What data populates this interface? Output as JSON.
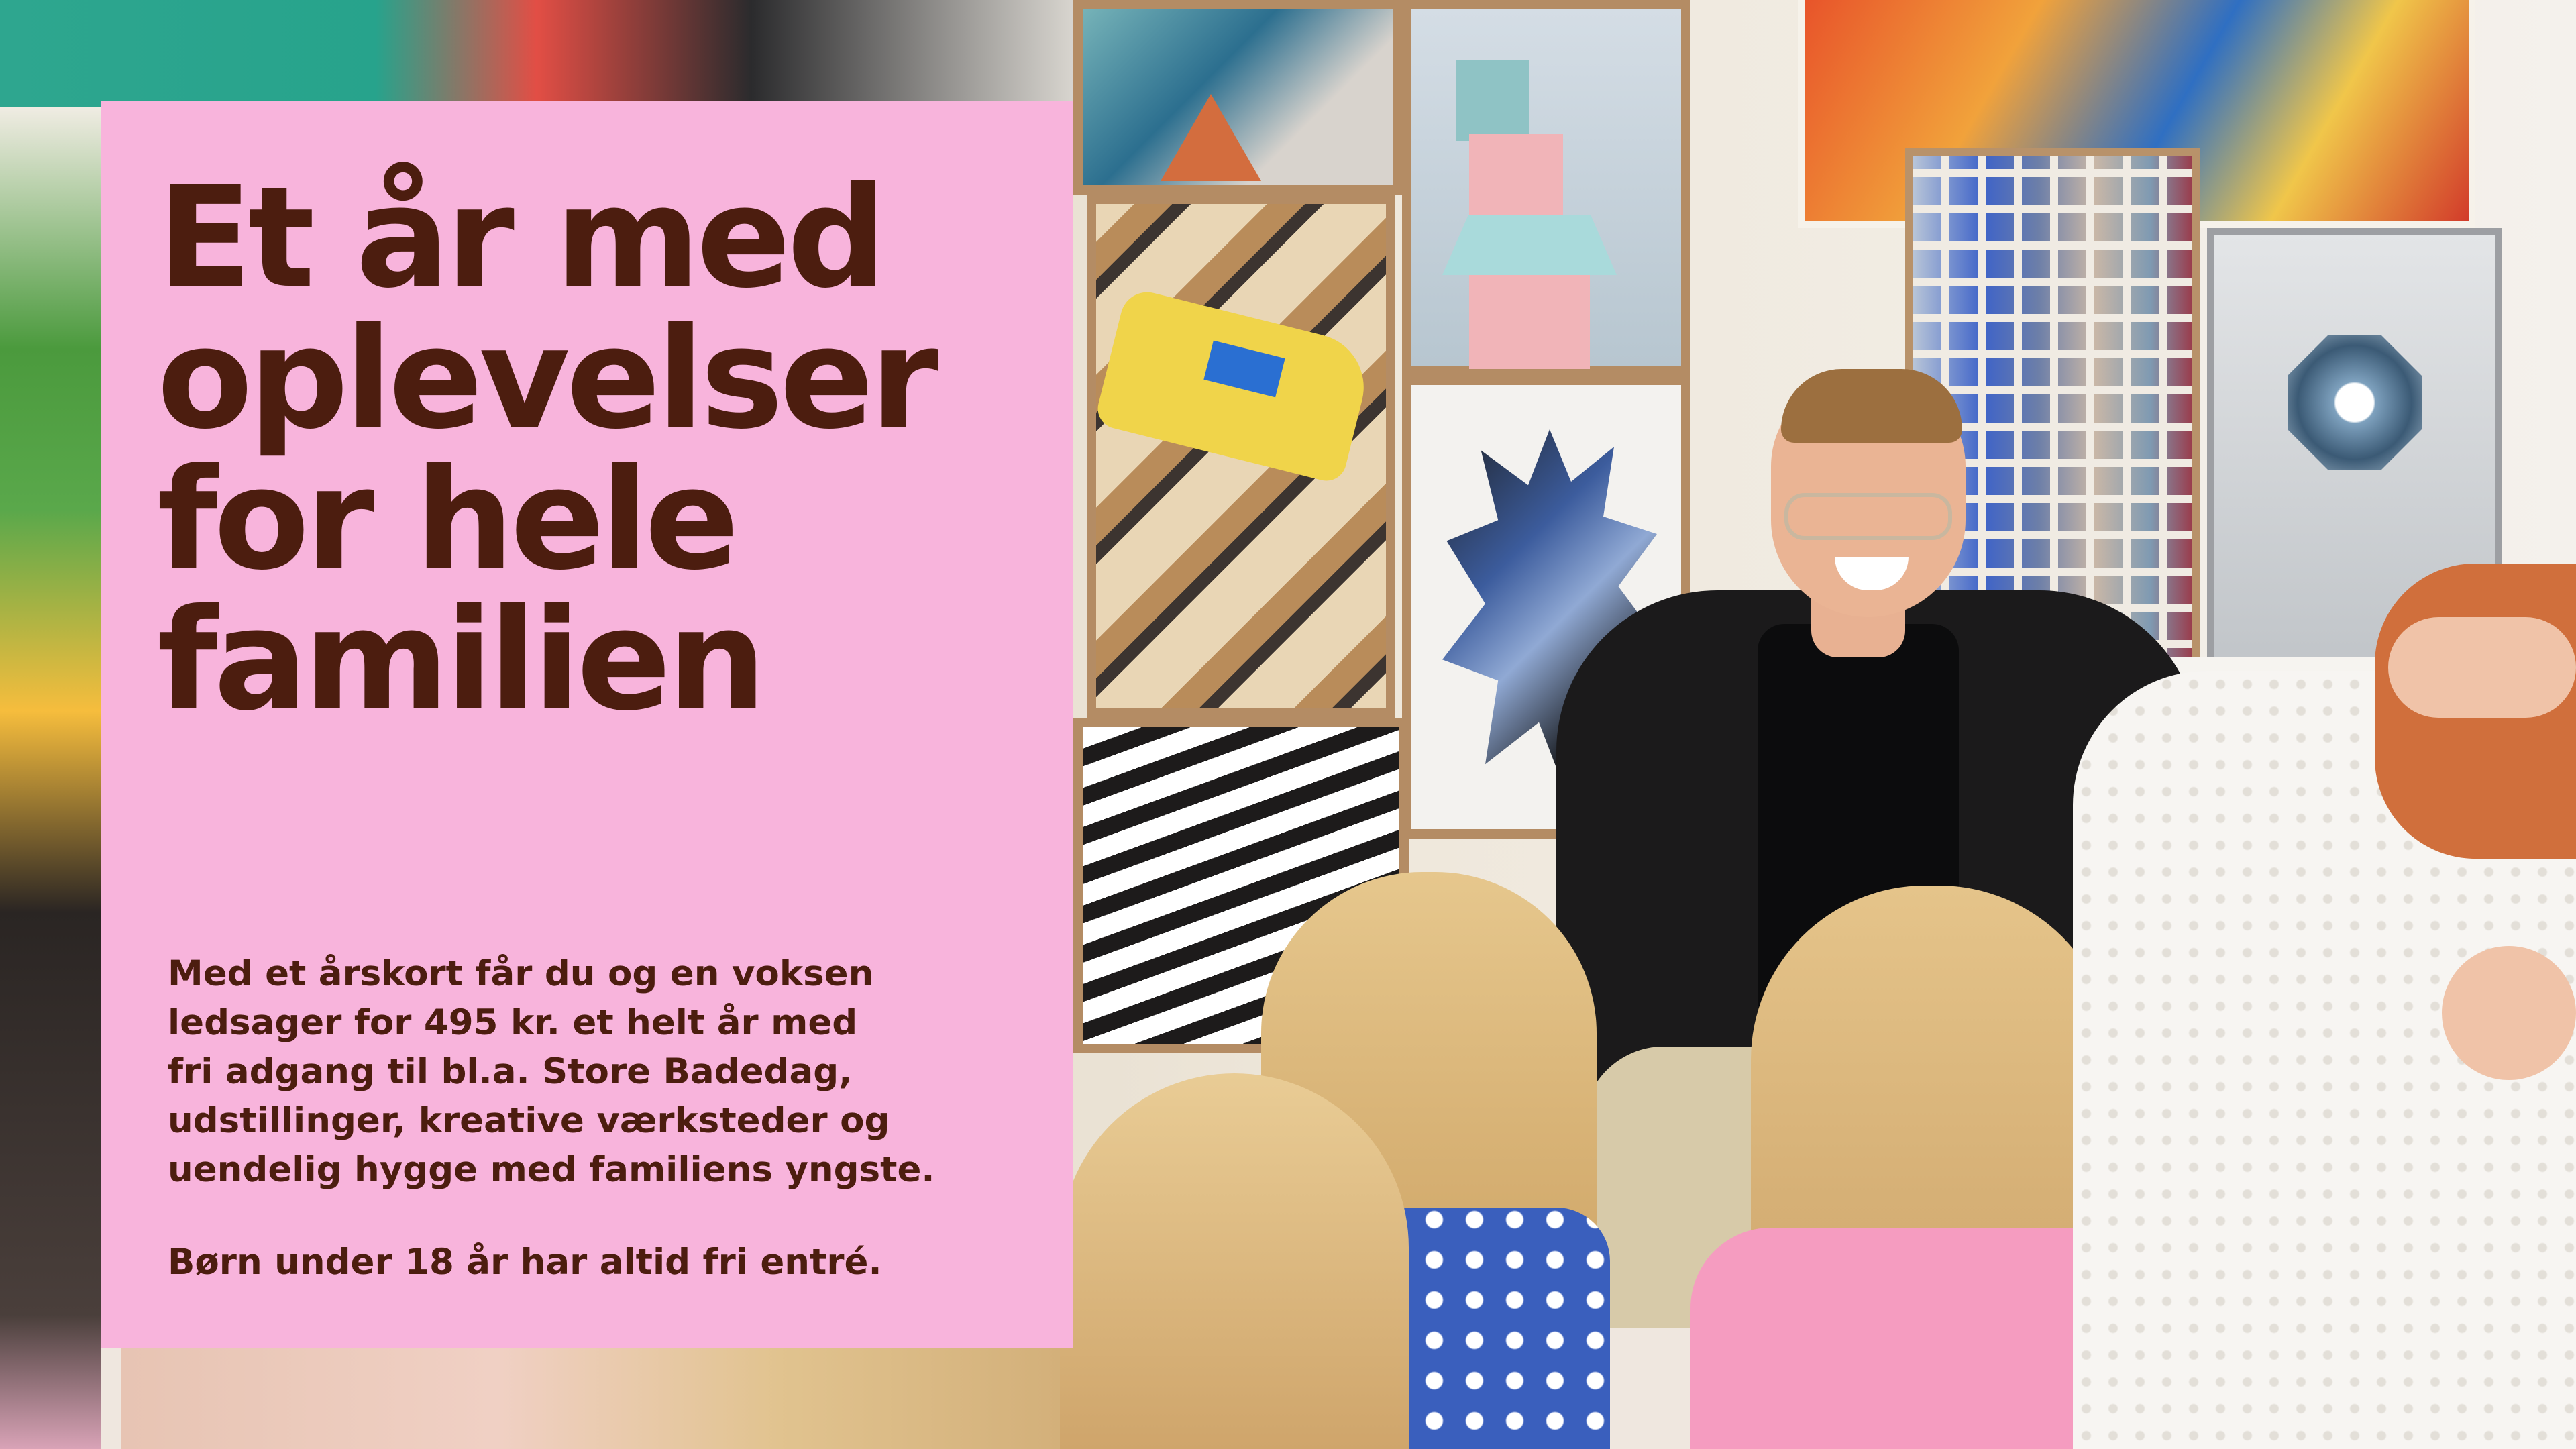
{
  "hero": {
    "headline_lines": [
      "Et år med",
      "oplevelser",
      "for hele",
      "familien"
    ],
    "body_lines": [
      "Med et årskort får du og en voksen",
      "ledsager for 495 kr. et helt år med",
      "fri adgang til bl.a. Store Badedag,",
      "udstillinger, kreative værksteder og",
      "uendelig hygge med familiens yngste."
    ],
    "note": "Børn under 18 år har altid fri entré."
  },
  "colors": {
    "panel_bg": "#f8b4dc",
    "text": "#4c1d0f"
  }
}
